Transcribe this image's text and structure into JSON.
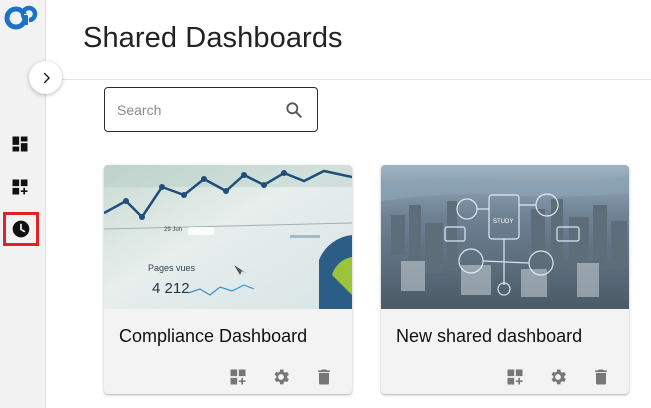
{
  "app": {
    "logo": "openmind-logo",
    "accent": "#1a73c6"
  },
  "sidebar": {
    "expand_icon": "chevron-right-icon",
    "items": [
      {
        "name": "dashboards",
        "icon": "dashboard-icon",
        "active": false
      },
      {
        "name": "add-dashboard",
        "icon": "dashboard-add-icon",
        "active": false
      },
      {
        "name": "history",
        "icon": "clock-icon",
        "active": true,
        "highlight": "#e02323"
      }
    ]
  },
  "header": {
    "title": "Shared Dashboards"
  },
  "search": {
    "placeholder": "Search",
    "value": "",
    "icon": "search-icon"
  },
  "cards": [
    {
      "title": "Compliance Dashboard",
      "thumbnail": {
        "kind": "analytics-chart-photo",
        "visible_text": [
          "29 Jun",
          "Pages vues",
          "4 212"
        ]
      },
      "actions": [
        "dashboard-add-icon",
        "settings-icon",
        "delete-icon"
      ]
    },
    {
      "title": "New shared dashboard",
      "thumbnail": {
        "kind": "city-aerial-photo",
        "visible_text": [
          "STUDY"
        ]
      },
      "actions": [
        "dashboard-add-icon",
        "settings-icon",
        "delete-icon"
      ]
    }
  ]
}
